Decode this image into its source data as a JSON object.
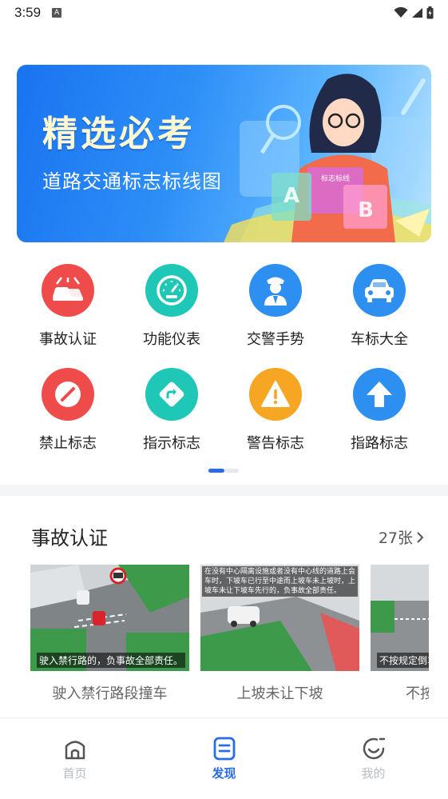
{
  "status_bar": {
    "time": "3:59",
    "notification_letter": "A"
  },
  "banner": {
    "title": "精选必考",
    "subtitle": "道路交通标志标线图",
    "board_label": "标志标线",
    "letter_a": "A",
    "letter_b": "B"
  },
  "features": [
    {
      "label": "事故认证",
      "icon": "car-crash-icon",
      "color": "#ef4b4b"
    },
    {
      "label": "功能仪表",
      "icon": "gauge-icon",
      "color": "#1fc7b6"
    },
    {
      "label": "交警手势",
      "icon": "traffic-police-icon",
      "color": "#2d8ff0"
    },
    {
      "label": "车标大全",
      "icon": "car-icon",
      "color": "#2d8ff0"
    },
    {
      "label": "禁止标志",
      "icon": "prohibition-sign-icon",
      "color": "#ef4b4b"
    },
    {
      "label": "指示标志",
      "icon": "direction-sign-icon",
      "color": "#1fc7b6"
    },
    {
      "label": "警告标志",
      "icon": "warning-sign-icon",
      "color": "#f6a623"
    },
    {
      "label": "指路标志",
      "icon": "arrow-up-icon",
      "color": "#2d8ff0"
    }
  ],
  "section": {
    "title": "事故认证",
    "count": "27张"
  },
  "cards": [
    {
      "name": "驶入禁行路段撞车",
      "caption": "驶入禁行路的，负事故全部责任。",
      "top_caption": ""
    },
    {
      "name": "上坡未让下坡",
      "caption": "",
      "top_caption": "在没有中心隔离设施或者没有中心线的道路上会车时，下坡车已行至中途而上坡车未上坡时，上坡车未让下坡车先行的，负事故全部责任。"
    },
    {
      "name": "不按",
      "caption": "不按规定倒车",
      "top_caption": ""
    }
  ],
  "tabs": [
    {
      "label": "首页",
      "icon": "home-icon",
      "active": false
    },
    {
      "label": "发现",
      "icon": "discover-icon",
      "active": true
    },
    {
      "label": "我的",
      "icon": "profile-icon",
      "active": false
    }
  ]
}
